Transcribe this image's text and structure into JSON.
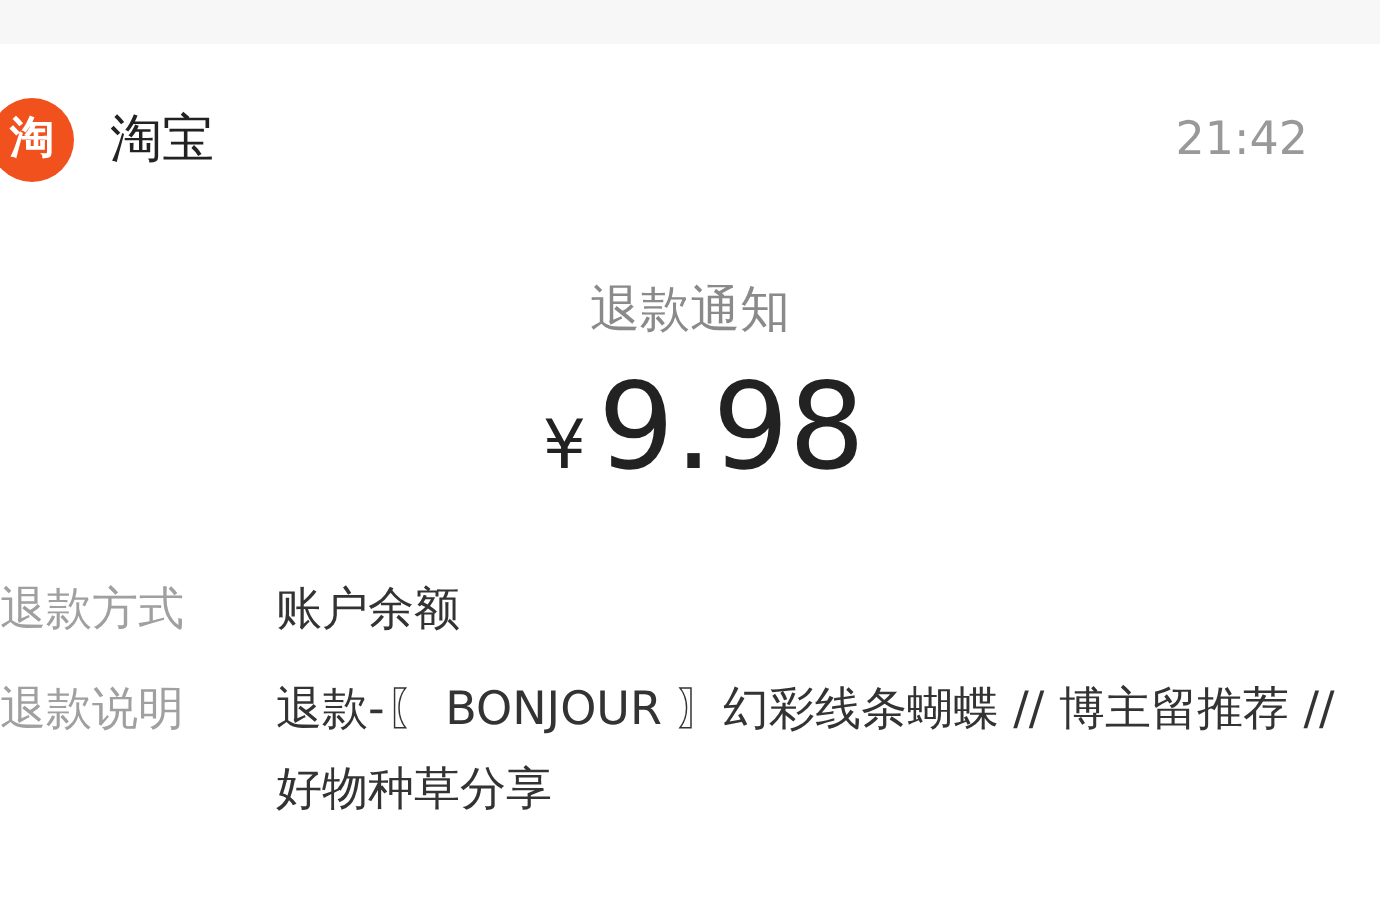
{
  "app": {
    "name": "淘宝",
    "icon_text": "淘",
    "time": "21:42"
  },
  "notice": {
    "title": "退款通知",
    "currency": "¥",
    "amount": "9.98"
  },
  "details": [
    {
      "label": "退款方式",
      "value": "账户余额"
    },
    {
      "label": "退款说明",
      "value": "退款-〖 BONJOUR 〗幻彩线条蝴蝶 // 博主留推荐 // 好物种草分享"
    }
  ]
}
